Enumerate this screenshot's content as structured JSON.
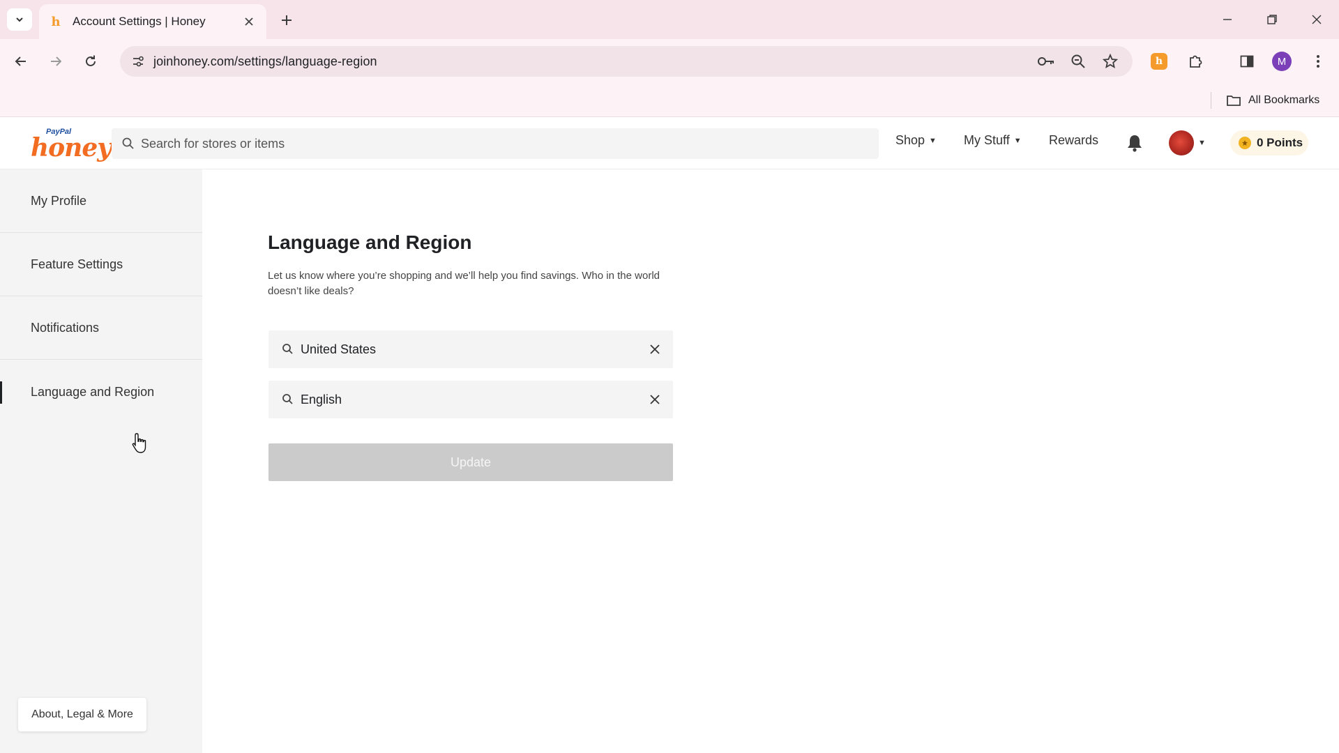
{
  "browser": {
    "tab_title": "Account Settings | Honey",
    "url": "joinhoney.com/settings/language-region",
    "profile_initial": "M",
    "bookmarks_label": "All Bookmarks"
  },
  "header": {
    "logo_top": "PayPal",
    "logo_main": "honey",
    "search_placeholder": "Search for stores or items",
    "nav": {
      "shop": "Shop",
      "my_stuff": "My Stuff",
      "rewards": "Rewards"
    },
    "points": "0 Points"
  },
  "sidebar": {
    "items": [
      {
        "label": "My Profile"
      },
      {
        "label": "Feature Settings"
      },
      {
        "label": "Notifications"
      },
      {
        "label": "Language and Region",
        "active": true
      }
    ],
    "footer_button": "About, Legal & More"
  },
  "main": {
    "title": "Language and Region",
    "description": "Let us know where you’re shopping and we’ll help you find savings. Who in the world doesn’t like deals?",
    "region_value": "United States",
    "language_value": "English",
    "update_label": "Update"
  },
  "colors": {
    "brand_orange": "#f26c21",
    "tabstrip_bg": "#f6e4ea",
    "sidebar_bg": "#f4f4f4",
    "button_disabled": "#cbcbcb"
  }
}
